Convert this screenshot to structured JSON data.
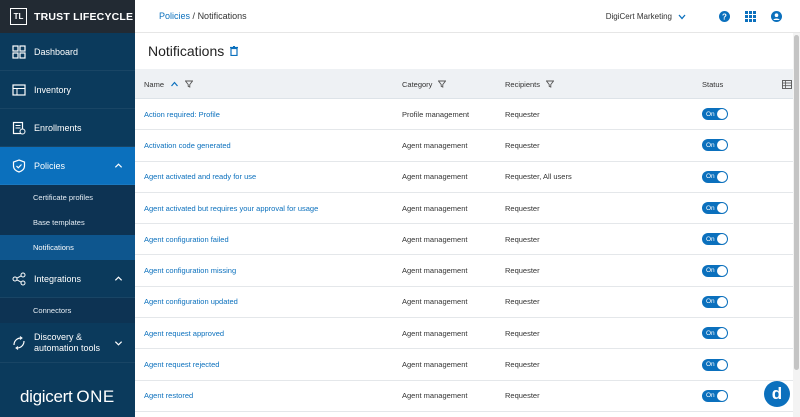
{
  "brand": {
    "logo_text": "TL",
    "name": "TRUST LIFECYCLE"
  },
  "sidebar": {
    "items": [
      {
        "label": "Dashboard",
        "icon": "dashboard-icon"
      },
      {
        "label": "Inventory",
        "icon": "inventory-icon"
      },
      {
        "label": "Enrollments",
        "icon": "enrollments-icon"
      },
      {
        "label": "Policies",
        "icon": "shield-icon",
        "expanded": true,
        "children": [
          "Certificate profiles",
          "Base templates",
          "Notifications"
        ]
      },
      {
        "label": "Integrations",
        "icon": "integrations-icon",
        "expanded": true,
        "children": [
          "Connectors"
        ]
      },
      {
        "label": "Discovery & automation tools",
        "label_line1": "Discovery &",
        "label_line2": "automation tools",
        "icon": "discovery-icon"
      }
    ],
    "footer": {
      "brand": "digicert",
      "product": "ONE"
    }
  },
  "topbar": {
    "breadcrumb_link": "Policies",
    "breadcrumb_sep": "/",
    "breadcrumb_current": "Notifications",
    "org": "DigiCert Marketing"
  },
  "page": {
    "title": "Notifications"
  },
  "table": {
    "columns": {
      "name": "Name",
      "category": "Category",
      "recipients": "Recipients",
      "status": "Status"
    },
    "rows": [
      {
        "name": "Action required: Profile",
        "category": "Profile management",
        "recipients": "Requester",
        "status": "On"
      },
      {
        "name": "Activation code generated",
        "category": "Agent management",
        "recipients": "Requester",
        "status": "On"
      },
      {
        "name": "Agent activated and ready for use",
        "category": "Agent management",
        "recipients": "Requester, All users",
        "status": "On"
      },
      {
        "name": "Agent activated but requires your approval for usage",
        "category": "Agent management",
        "recipients": "Requester",
        "status": "On"
      },
      {
        "name": "Agent configuration failed",
        "category": "Agent management",
        "recipients": "Requester",
        "status": "On"
      },
      {
        "name": "Agent configuration missing",
        "category": "Agent management",
        "recipients": "Requester",
        "status": "On"
      },
      {
        "name": "Agent configuration updated",
        "category": "Agent management",
        "recipients": "Requester",
        "status": "On"
      },
      {
        "name": "Agent request approved",
        "category": "Agent management",
        "recipients": "Requester",
        "status": "On"
      },
      {
        "name": "Agent request rejected",
        "category": "Agent management",
        "recipients": "Requester",
        "status": "On"
      },
      {
        "name": "Agent restored",
        "category": "Agent management",
        "recipients": "Requester",
        "status": "On"
      }
    ]
  },
  "chat": {
    "label": "d"
  },
  "colors": {
    "sidebar": "#0b3a5c",
    "accent": "#0b70bd",
    "brand_bar": "#222a33"
  }
}
